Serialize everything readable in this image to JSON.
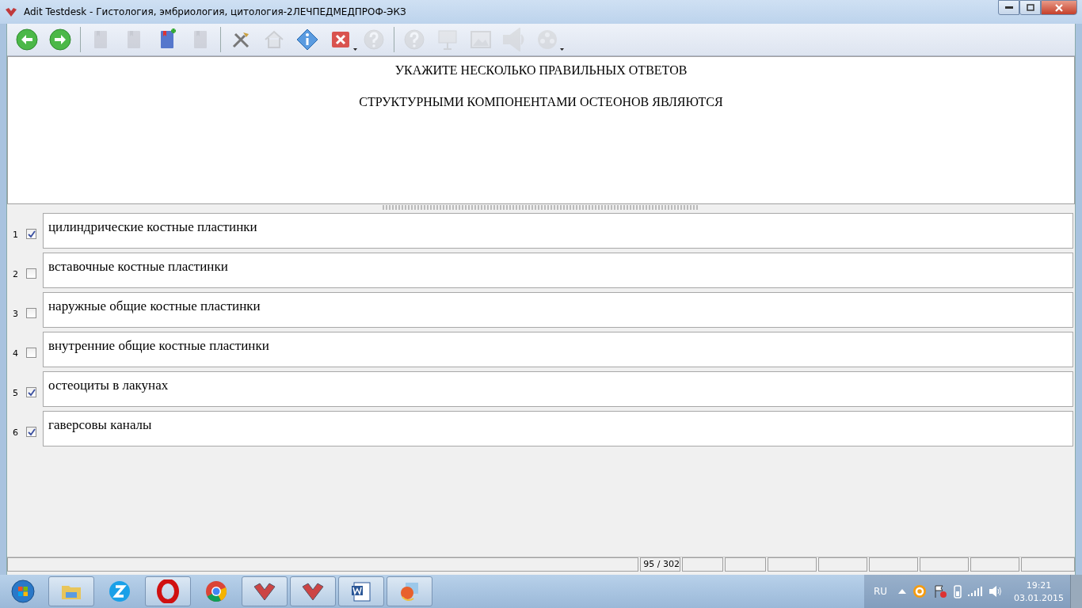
{
  "window": {
    "title": "Adit Testdesk - Гистология, эмбриология, цитология-2ЛЕЧПЕДМЕДПРОФ-ЭКЗ"
  },
  "toolbar": [
    {
      "kind": "back",
      "disabled": false
    },
    {
      "kind": "forward",
      "disabled": false
    },
    {
      "kind": "sep"
    },
    {
      "kind": "book-prev",
      "disabled": true
    },
    {
      "kind": "book-next",
      "disabled": true
    },
    {
      "kind": "bookmark-add",
      "disabled": false
    },
    {
      "kind": "book",
      "disabled": true
    },
    {
      "kind": "sep"
    },
    {
      "kind": "tools",
      "disabled": false
    },
    {
      "kind": "home",
      "disabled": true
    },
    {
      "kind": "info",
      "disabled": false
    },
    {
      "kind": "close",
      "disabled": false,
      "dropdown": true
    },
    {
      "kind": "help",
      "disabled": true
    },
    {
      "kind": "sep"
    },
    {
      "kind": "hint",
      "disabled": true
    },
    {
      "kind": "presentation",
      "disabled": true
    },
    {
      "kind": "picture",
      "disabled": true
    },
    {
      "kind": "sound",
      "disabled": true
    },
    {
      "kind": "video",
      "disabled": true,
      "dropdown": true
    }
  ],
  "question": {
    "instruction": "УКАЖИТЕ НЕСКОЛЬКО ПРАВИЛЬНЫХ ОТВЕТОВ",
    "text": "СТРУКТУРНЫМИ КОМПОНЕНТАМИ ОСТЕОНОВ ЯВЛЯЮТСЯ"
  },
  "answers": [
    {
      "number": "1",
      "text": "цилиндрические костные пластинки",
      "checked": true
    },
    {
      "number": "2",
      "text": "вставочные костные пластинки",
      "checked": false
    },
    {
      "number": "3",
      "text": "наружные общие костные пластинки",
      "checked": false
    },
    {
      "number": "4",
      "text": "внутренние общие костные пластинки",
      "checked": false
    },
    {
      "number": "5",
      "text": "остеоциты в лакунах",
      "checked": true
    },
    {
      "number": "6",
      "text": "гаверсовы каналы",
      "checked": true
    }
  ],
  "status_bar": {
    "progress": "95 / 302"
  },
  "taskbar": {
    "apps": [
      {
        "kind": "folder",
        "running": true
      },
      {
        "kind": "z",
        "running": false
      },
      {
        "kind": "opera",
        "running": true
      },
      {
        "kind": "chrome",
        "running": false
      },
      {
        "kind": "testdesk",
        "running": true
      },
      {
        "kind": "testdesk",
        "running": true
      },
      {
        "kind": "word",
        "running": true
      },
      {
        "kind": "slides",
        "running": true
      }
    ],
    "language": "RU",
    "time": "19:21",
    "date": "03.01.2015"
  }
}
